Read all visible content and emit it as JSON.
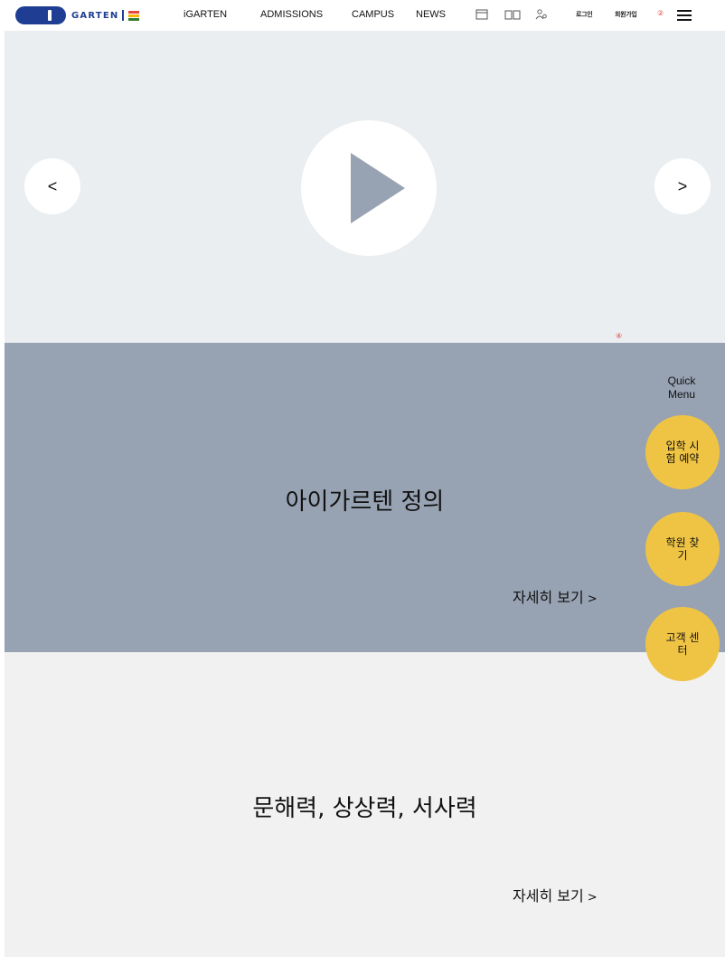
{
  "header": {
    "logo_text": "GARTEN",
    "nav": [
      "iGARTEN",
      "ADMISSIONS",
      "CAMPUS",
      "NEWS"
    ],
    "icons": [
      "layout-icon",
      "book-icon",
      "users-icon"
    ],
    "lang": [
      "로그인",
      "회원가입"
    ],
    "mark": "②"
  },
  "video": {
    "prev_label": "<",
    "next_label": ">"
  },
  "section1": {
    "title": "아이가르텐 정의",
    "more": "자세히 보기",
    "more_arrow": ">",
    "mark": "④"
  },
  "section2": {
    "title": "문해력, 상상력, 서사력",
    "more": "자세히 보기",
    "more_arrow": ">"
  },
  "quick_menu": {
    "label_line1": "Quick",
    "label_line2": "Menu",
    "buttons": [
      "입학 시험 예약",
      "학원 찾기",
      "고객 센터"
    ]
  },
  "colors": {
    "brand": "#1f3e93",
    "section1_bg": "#97a2b2",
    "quick_button": "#efc445"
  }
}
